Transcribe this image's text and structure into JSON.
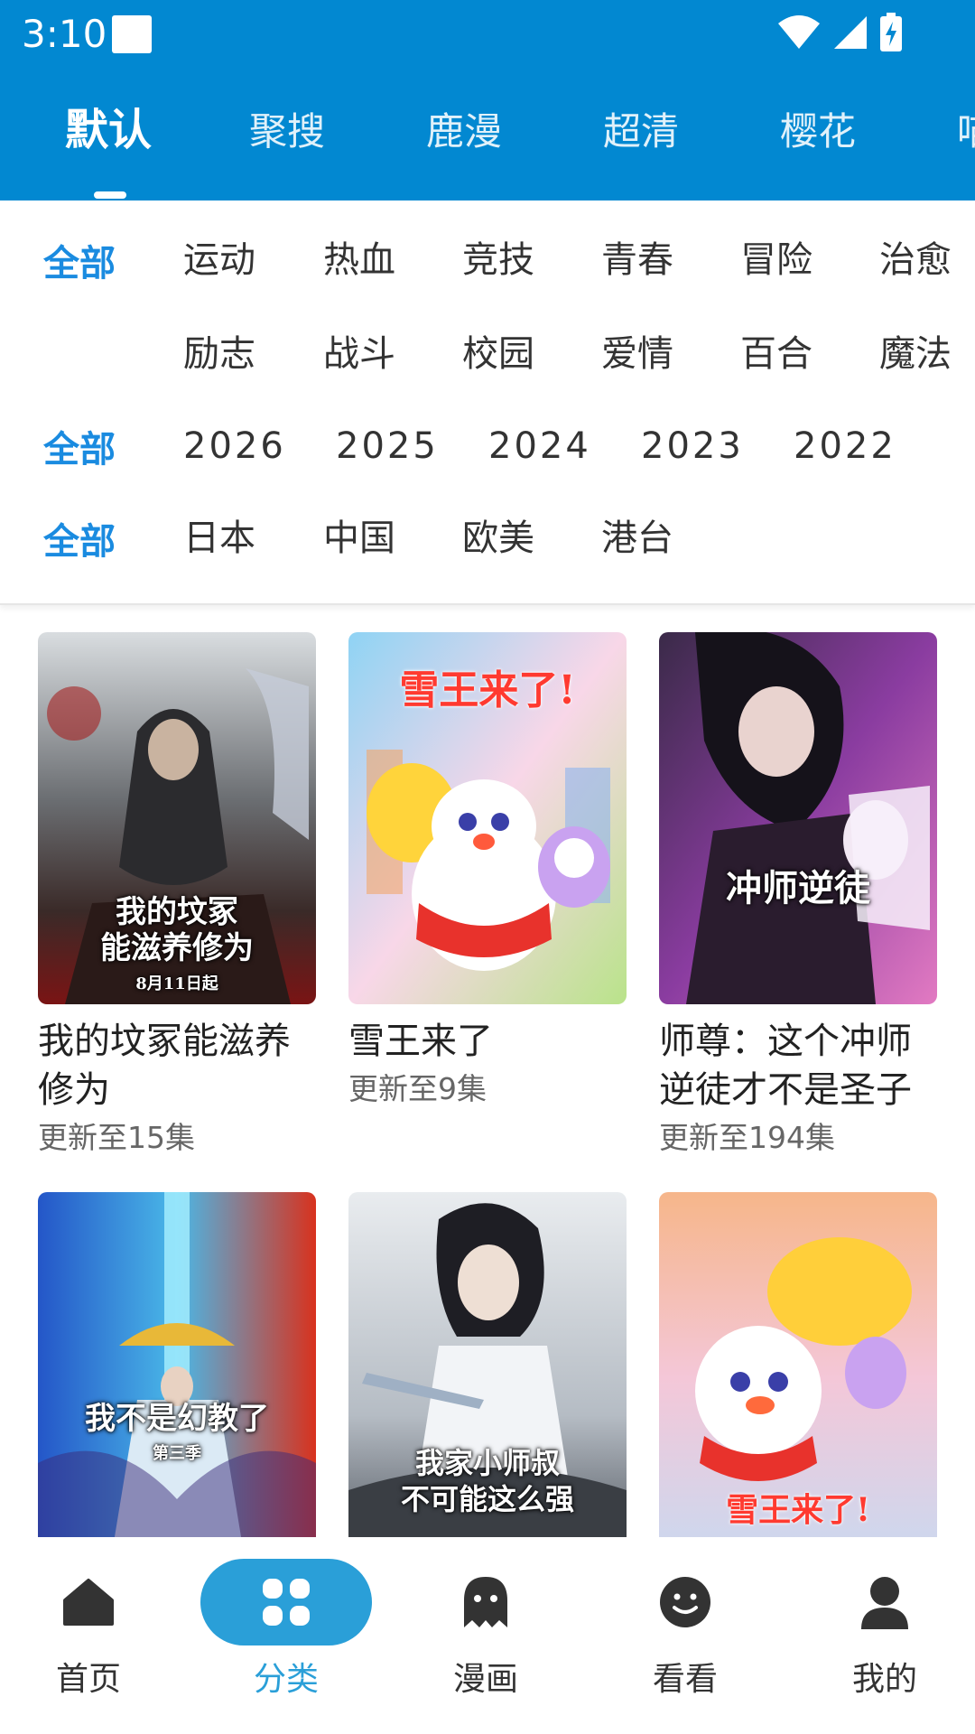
{
  "status_bar": {
    "time": "3:10"
  },
  "source_tabs": [
    {
      "label": "默认",
      "active": true
    },
    {
      "label": "聚搜",
      "active": false
    },
    {
      "label": "鹿漫",
      "active": false
    },
    {
      "label": "超清",
      "active": false
    },
    {
      "label": "樱花",
      "active": false
    },
    {
      "label": "喵",
      "active": false
    }
  ],
  "filters": {
    "genre_all": "全部",
    "genres_row1": [
      "运动",
      "热血",
      "竞技",
      "青春",
      "冒险",
      "治愈"
    ],
    "genres_row2": [
      "励志",
      "战斗",
      "校园",
      "爱情",
      "百合",
      "魔法"
    ],
    "year_all": "全部",
    "years": [
      "2026",
      "2025",
      "2024",
      "2023",
      "2022"
    ],
    "region_all": "全部",
    "regions": [
      "日本",
      "中国",
      "欧美",
      "港台"
    ]
  },
  "cards": [
    {
      "title": "我的坟冢能滋养修为",
      "subtitle": "更新至15集",
      "cover_caption": "我的坟冢\n能滋养修为",
      "cover_date": "8月11日起"
    },
    {
      "title": "雪王来了",
      "subtitle": "更新至9集",
      "cover_caption": "雪王来了!"
    },
    {
      "title": "师尊：这个冲师逆徒才不是圣子",
      "subtitle": "更新至194集",
      "cover_caption": "冲师逆徒"
    },
    {
      "title": "",
      "subtitle": "",
      "cover_caption": "我不是幻教了",
      "cover_date": "第三季"
    },
    {
      "title": "",
      "subtitle": "",
      "cover_caption": "我家小师叔\n不可能这么强"
    },
    {
      "title": "",
      "subtitle": "",
      "cover_caption": "雪王来了!"
    }
  ],
  "bottom_nav": [
    {
      "label": "首页",
      "icon": "home-icon",
      "active": false
    },
    {
      "label": "分类",
      "icon": "grid-icon",
      "active": true
    },
    {
      "label": "漫画",
      "icon": "ghost-icon",
      "active": false
    },
    {
      "label": "看看",
      "icon": "smile-icon",
      "active": false
    },
    {
      "label": "我的",
      "icon": "person-icon",
      "active": false
    }
  ],
  "colors": {
    "header_bg": "#0288d1",
    "accent": "#1a8be0",
    "nav_active": "#2a9fd8"
  }
}
